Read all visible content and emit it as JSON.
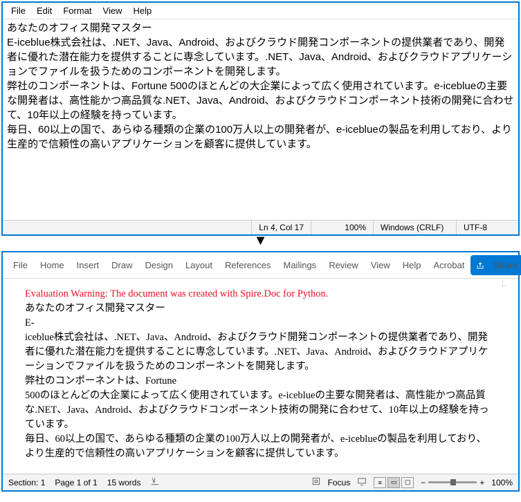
{
  "notepad": {
    "menu": [
      "File",
      "Edit",
      "Format",
      "View",
      "Help"
    ],
    "para1": "あなたのオフィス開発マスター",
    "para2": "E-iceblue株式会社は、.NET、Java、Android、およびクラウド開発コンポーネントの提供業者であり、開発者に優れた潜在能力を提供することに専念しています。.NET、Java、Android、およびクラウドアプリケーションでファイルを扱うためのコンポーネントを開発します。",
    "para3": "弊社のコンポーネントは、Fortune 500のほとんどの大企業によって広く使用されています。e-iceblueの主要な開発者は、高性能かつ高品質な.NET、Java、Android、およびクラウドコンポーネント技術の開発に合わせて、10年以上の経験を持っています。",
    "para4": "毎日、60以上の国で、あらゆる種類の企業の100万人以上の開発者が、e-iceblueの製品を利用しており、より生産的で信頼性の高いアプリケーションを顧客に提供しています。",
    "status": {
      "cursor": "Ln 4, Col 17",
      "zoom": "100%",
      "eol": "Windows (CRLF)",
      "encoding": "UTF-8"
    }
  },
  "word": {
    "tabs": [
      "File",
      "Home",
      "Insert",
      "Draw",
      "Design",
      "Layout",
      "References",
      "Mailings",
      "Review",
      "View",
      "Help",
      "Acrobat"
    ],
    "share": "Share",
    "eval": "Evaluation Warning: The document was created with Spire.Doc for Python.",
    "l1": "あなたのオフィス開発マスター",
    "l2": "E-",
    "l3": "iceblue株式会社は、.NET、Java、Android、およびクラウド開発コンポーネントの提供業者であり、開発者に優れた潜在能力を提供することに専念しています。.NET、Java、Android、およびクラウドアプリケーションでファイルを扱うためのコンポーネントを開発します。",
    "l4": "弊社のコンポーネントは、Fortune",
    "l5": "500のほとんどの大企業によって広く使用されています。e-iceblueの主要な開発者は、高性能かつ高品質な.NET、Java、Android、およびクラウドコンポーネント技術の開発に合わせて、10年以上の経験を持っています。",
    "l6": "毎日、60以上の国で、あらゆる種類の企業の100万人以上の開発者が、e-iceblueの製品を利用しており、より生産的で信頼性の高いアプリケーションを顧客に提供しています。",
    "status": {
      "section": "Section: 1",
      "page": "Page 1 of 1",
      "words": "15 words",
      "focus": "Focus",
      "zoom": "100%"
    }
  }
}
